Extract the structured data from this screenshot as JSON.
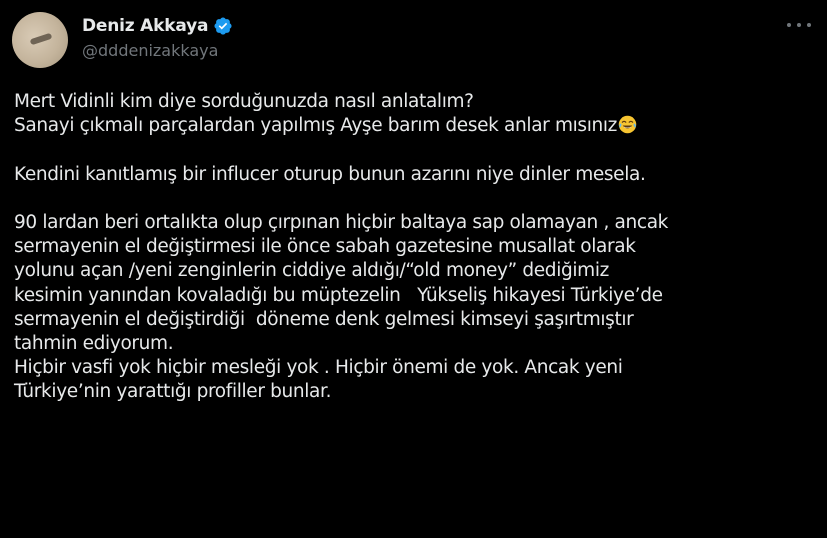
{
  "author": {
    "display_name": "Deniz Akkaya",
    "handle": "@dddenizakkaya",
    "verified_icon": "verified-badge-icon",
    "verified_color": "#1d9bf0"
  },
  "more_menu": {
    "icon": "more-dots-icon"
  },
  "tweet": {
    "line1": "Mert Vidinli kim diye sorduğunuzda nasıl anlatalım?",
    "line2": "Sanayi çıkmalı parçalardan yapılmış Ayşe barım desek anlar mısınız",
    "line2_emoji": "face-with-tears-of-joy-emoji",
    "line3": "Kendini kanıtlamış bir influcer oturup bunun azarını niye dinler mesela.",
    "line4": "90 lardan beri ortalıkta olup çırpınan hiçbir baltaya sap olamayan , ancak",
    "line5": "sermayenin el değiştirmesi ile önce sabah gazetesine musallat olarak",
    "line6": "yolunu açan /yeni zenginlerin ciddiye aldığı/“old money” dediğimiz",
    "line7": "kesimin yanından kovaladığı bu müptezelin   Yükseliş hikayesi Türkiye’de",
    "line8": "sermayenin el değiştirdiği  döneme denk gelmesi kimseyi şaşırtmıştır",
    "line9": "tahmin ediyorum.",
    "line10": "Hiçbir vasfi yok hiçbir mesleği yok . Hiçbir önemi de yok. Ancak yeni",
    "line11": "Türkiye’nin yarattığı profiller bunlar."
  },
  "colors": {
    "background": "#000000",
    "text": "#e7e9ea",
    "secondary": "#71767b"
  }
}
